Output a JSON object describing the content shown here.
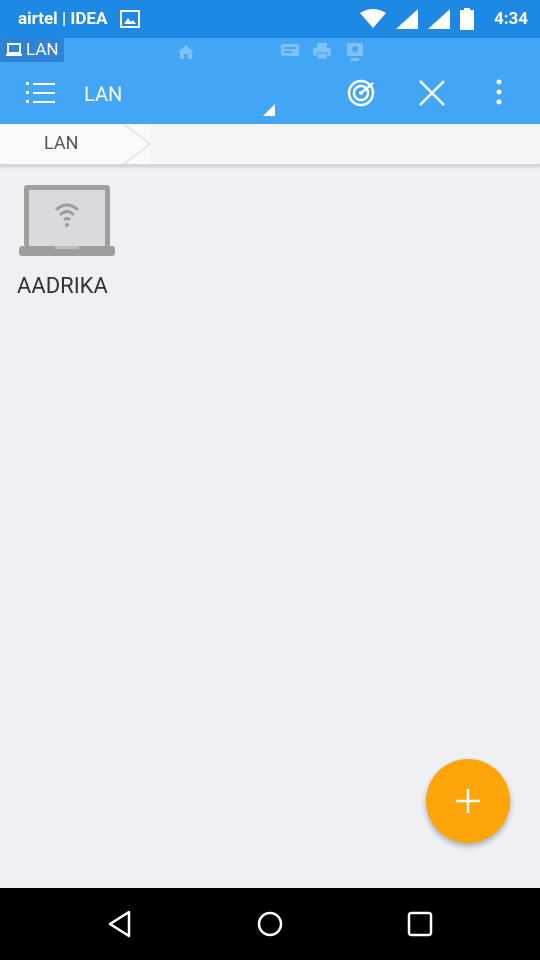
{
  "status_bar": {
    "carrier": "airtel | IDEA",
    "time": "4:34"
  },
  "toolbar": {
    "active_mini_tab": "LAN",
    "title": "LAN"
  },
  "breadcrumb": {
    "items": [
      "LAN"
    ]
  },
  "devices": [
    {
      "name": "AADRIKA",
      "icon": "laptop-wifi-icon"
    }
  ],
  "colors": {
    "status_bar": "#1e88e5",
    "toolbar": "#42a5f5",
    "fab": "#ffa50a",
    "background": "#eff0f3"
  }
}
